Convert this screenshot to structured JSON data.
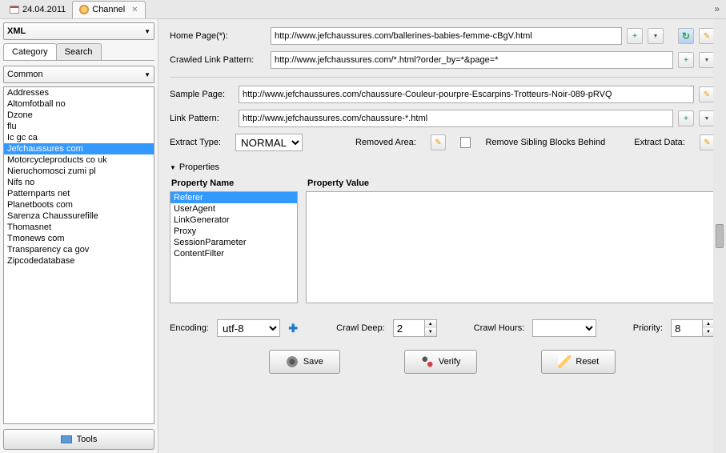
{
  "tabs": {
    "date": "24.04.2011",
    "channel": "Channel"
  },
  "leftPanel": {
    "xmlLabel": "XML",
    "subTabs": {
      "category": "Category",
      "search": "Search"
    },
    "commonLabel": "Common",
    "list": [
      "Addresses",
      "Altomfotball no",
      "Dzone",
      "flu",
      "Ic gc ca",
      "Jefchaussures com",
      "Motorcycleproducts co uk",
      "Nieruchomosci zumi pl",
      "Nifs no",
      "Patternparts net",
      "Planetboots com",
      "Sarenza Chaussurefille",
      "Thomasnet",
      "Tmonews com",
      "Transparency ca gov",
      "Zipcodedatabase"
    ],
    "selectedIndex": 5,
    "toolsLabel": "Tools"
  },
  "form": {
    "homePageLabel": "Home Page(*):",
    "homePageValue": "http://www.jefchaussures.com/ballerines-babies-femme-cBgV.html",
    "crawledLinkLabel": "Crawled Link Pattern:",
    "crawledLinkValue": "http://www.jefchaussures.com/*.html?order_by=*&page=*",
    "samplePageLabel": "Sample Page:",
    "samplePageValue": "http://www.jefchaussures.com/chaussure-Couleur-pourpre-Escarpins-Trotteurs-Noir-089-pRVQ",
    "linkPatternLabel": "Link Pattern:",
    "linkPatternValue": "http://www.jefchaussures.com/chaussure-*.html",
    "extractTypeLabel": "Extract Type:",
    "extractTypeValue": "NORMAL",
    "removedAreaLabel": "Removed Area:",
    "removeSiblingLabel": "Remove Sibling Blocks Behind",
    "extractDataLabel": "Extract Data:"
  },
  "properties": {
    "sectionLabel": "Properties",
    "nameHeader": "Property Name",
    "valueHeader": "Property Value",
    "items": [
      "Referer",
      "UserAgent",
      "LinkGenerator",
      "Proxy",
      "SessionParameter",
      "ContentFilter"
    ],
    "selectedIndex": 0
  },
  "bottom": {
    "encodingLabel": "Encoding:",
    "encodingValue": "utf-8",
    "crawlDeepLabel": "Crawl Deep:",
    "crawlDeepValue": "2",
    "crawlHoursLabel": "Crawl Hours:",
    "crawlHoursValue": "",
    "priorityLabel": "Priority:",
    "priorityValue": "8"
  },
  "buttons": {
    "save": "Save",
    "verify": "Verify",
    "reset": "Reset"
  }
}
